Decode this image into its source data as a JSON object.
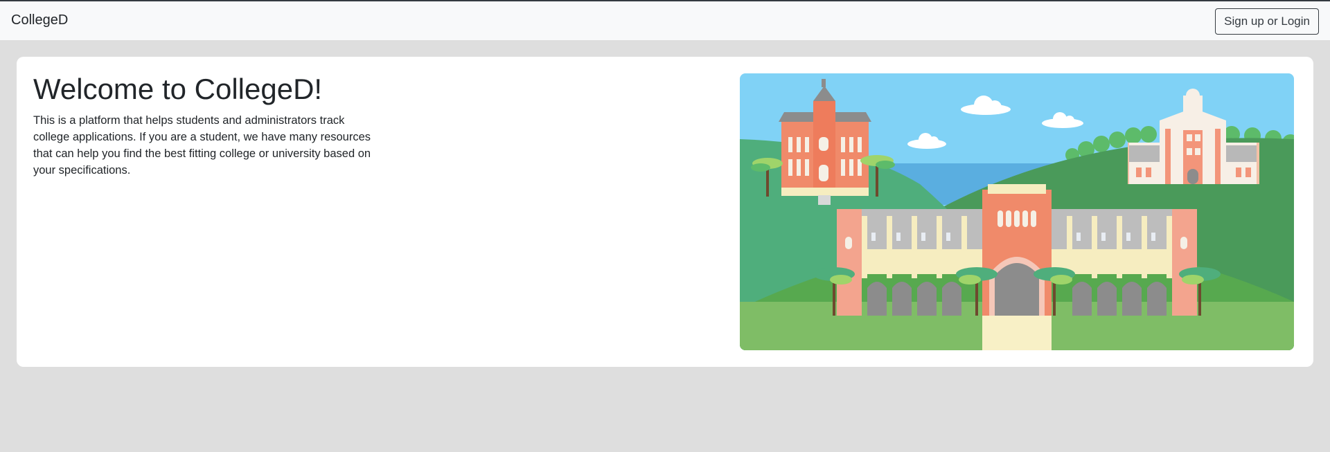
{
  "navbar": {
    "brand": "CollegeD",
    "login_label": "Sign up or Login"
  },
  "hero": {
    "title": "Welcome to CollegeD!",
    "description": "This is a platform that helps students and administrators track college applications. If you are a student, we have many resources that can help you find the best fitting college or university based on your specifications.",
    "illustration": "college-campus-illustration"
  },
  "colors": {
    "page_background": "#dedede",
    "navbar_background": "#f8f9fa",
    "card_background": "#ffffff",
    "text": "#212529",
    "sky": "#7fd3f7",
    "hill_green": "#4a9a5a",
    "building_salmon": "#f28b6c"
  }
}
